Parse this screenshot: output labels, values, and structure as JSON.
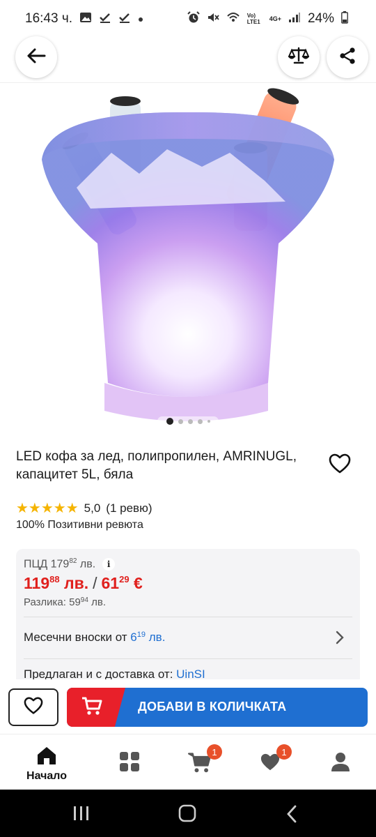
{
  "status_bar": {
    "time": "16:43 ч.",
    "network": "Vo) LTE1",
    "network_gen": "4G+",
    "battery": "24%"
  },
  "header": {
    "back_icon": "arrow-left-icon",
    "compare_icon": "scales-icon",
    "share_icon": "share-icon"
  },
  "gallery": {
    "image_alt": "LED ice bucket with bottles",
    "total_dots": 5,
    "active_index": 0
  },
  "product": {
    "title": "LED кофа за лед, полипропилен, AMRINUGL, капацитет 5L, бяла",
    "rating_value": "5,0",
    "review_count": "(1 ревю)",
    "stars": 5,
    "positive": "100% Позитивни ревюта"
  },
  "price": {
    "pcd_label": "ПЦД",
    "pcd_main": "179",
    "pcd_cents": "82",
    "pcd_currency": "лв.",
    "price_main": "119",
    "price_cents": "88",
    "price_currency": "лв.",
    "separator": "/",
    "eur_main": "61",
    "eur_cents": "29",
    "eur_currency": "€",
    "diff_label": "Разлика:",
    "diff_main": "59",
    "diff_cents": "94",
    "diff_currency": "лв.",
    "monthly_label": "Месечни вноски от",
    "monthly_main": "6",
    "monthly_cents": "19",
    "monthly_currency": "лв.",
    "seller_label": "Предлаган и с доставка от:",
    "seller_name": "UinSI"
  },
  "actions": {
    "add_to_cart": "ДОБАВИ В КОЛИЧКАТА"
  },
  "bottom_nav": {
    "home_label": "Начало",
    "cart_badge": "1",
    "favorites_badge": "1"
  },
  "colors": {
    "brand_blue": "#1f6fd1",
    "brand_red": "#e8202a",
    "price_red": "#e0201d",
    "star_yellow": "#f5b400",
    "badge_orange": "#e8502a"
  }
}
